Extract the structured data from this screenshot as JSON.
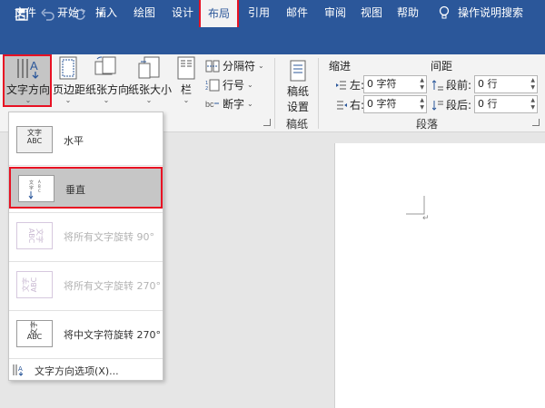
{
  "quick_access": {
    "save_icon": "save-icon",
    "undo_icon": "undo-icon",
    "redo_icon": "redo-icon",
    "customize_icon": "customize-qat-icon"
  },
  "menu": {
    "tabs": [
      "文件",
      "开始",
      "插入",
      "绘图",
      "设计",
      "布局",
      "引用",
      "邮件",
      "审阅",
      "视图",
      "帮助"
    ],
    "active_tab": "布局",
    "search_label": "操作说明搜索"
  },
  "ribbon": {
    "text_direction": "文字方向",
    "margins": "页边距",
    "orientation": "纸张方向",
    "size": "纸张大小",
    "columns": "栏",
    "breaks": "分隔符",
    "line_numbers": "行号",
    "hyphenation": "断字",
    "draft_settings_line1": "稿纸",
    "draft_settings_line2": "设置",
    "draft_group": "稿纸",
    "indent_title": "缩进",
    "spacing_title": "间距",
    "indent_left_label": "左:",
    "indent_right_label": "右:",
    "indent_left_value": "0 字符",
    "indent_right_value": "0 字符",
    "spacing_before_label": "段前:",
    "spacing_after_label": "段后:",
    "spacing_before_value": "0 行",
    "spacing_after_value": "0 行",
    "paragraph_group": "段落"
  },
  "dropdown": {
    "horizontal": "水平",
    "vertical": "垂直",
    "rotate90": "将所有文字旋转 90°",
    "rotate270": "将所有文字旋转 270°",
    "cjk270": "将中文字符旋转 270°",
    "options": "文字方向选项(X)...",
    "thumb_wenzi": "文字",
    "thumb_abc": "ABC"
  },
  "colors": {
    "title_bg": "#2b579a",
    "highlight": "#e81123",
    "hover_bg": "#c6c6c6"
  }
}
